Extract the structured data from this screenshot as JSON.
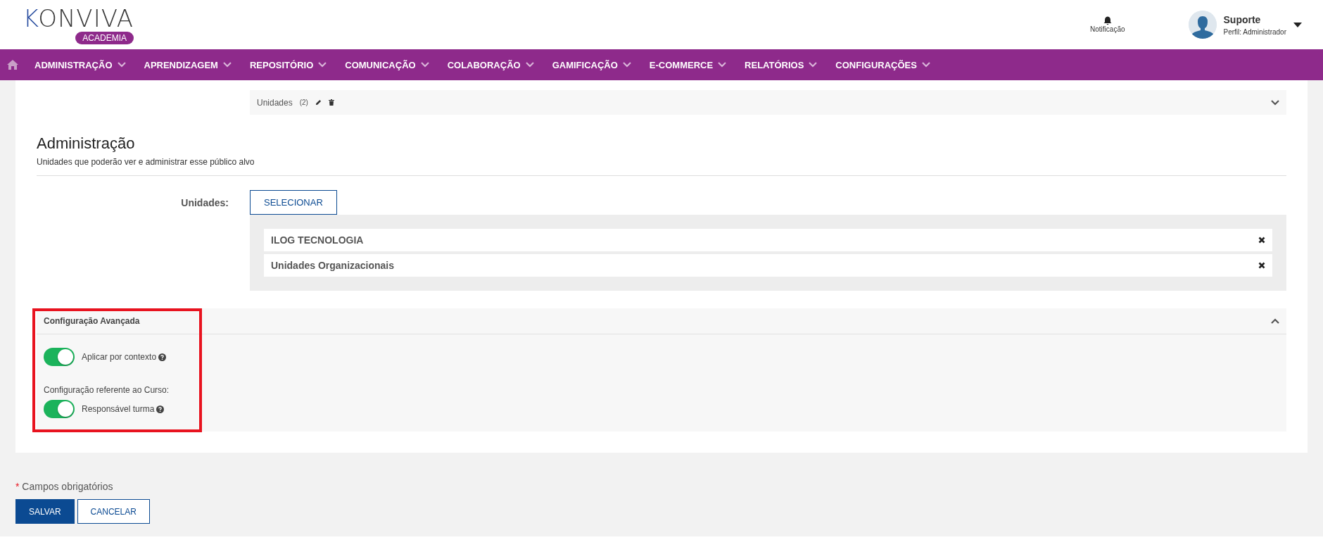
{
  "header": {
    "logo": {
      "wordmark": "KONVIVA",
      "badge": "ACADEMIA"
    },
    "notification": {
      "label": "Notificação"
    },
    "user": {
      "name": "Suporte",
      "profile": "Perfil: Administrador"
    }
  },
  "nav": {
    "items": [
      {
        "label": "ADMINISTRAÇÃO"
      },
      {
        "label": "APRENDIZAGEM"
      },
      {
        "label": "REPOSITÓRIO"
      },
      {
        "label": "COMUNICAÇÃO"
      },
      {
        "label": "COLABORAÇÃO"
      },
      {
        "label": "GAMIFICAÇÃO"
      },
      {
        "label": "E-COMMERCE"
      },
      {
        "label": "RELATÓRIOS"
      },
      {
        "label": "CONFIGURAÇÕES"
      }
    ]
  },
  "summary_bar": {
    "label": "Unidades",
    "count": "(2)",
    "expanded": false
  },
  "section": {
    "title": "Administração",
    "subtitle": "Unidades que poderão ver e administrar esse público alvo",
    "field_label": "Unidades:",
    "select_button": "SELECIONAR",
    "items": [
      {
        "label": "ILOG TECNOLOGIA"
      },
      {
        "label": "Unidades Organizacionais"
      }
    ]
  },
  "advanced": {
    "title": "Configuração Avançada",
    "expanded": true,
    "highlighted": true,
    "settings": [
      {
        "kind": "toggle",
        "label": "Aplicar por contexto",
        "on": true,
        "help": true
      },
      {
        "kind": "heading",
        "label": "Configuração referente ao Curso:"
      },
      {
        "kind": "toggle",
        "label": "Responsável turma",
        "on": true,
        "help": true
      }
    ]
  },
  "footer": {
    "required_mark": "*",
    "required_note": "Campos obrigatórios",
    "buttons": [
      {
        "label": "SALVAR",
        "kind": "primary"
      },
      {
        "label": "CANCELAR",
        "kind": "secondary"
      }
    ]
  }
}
